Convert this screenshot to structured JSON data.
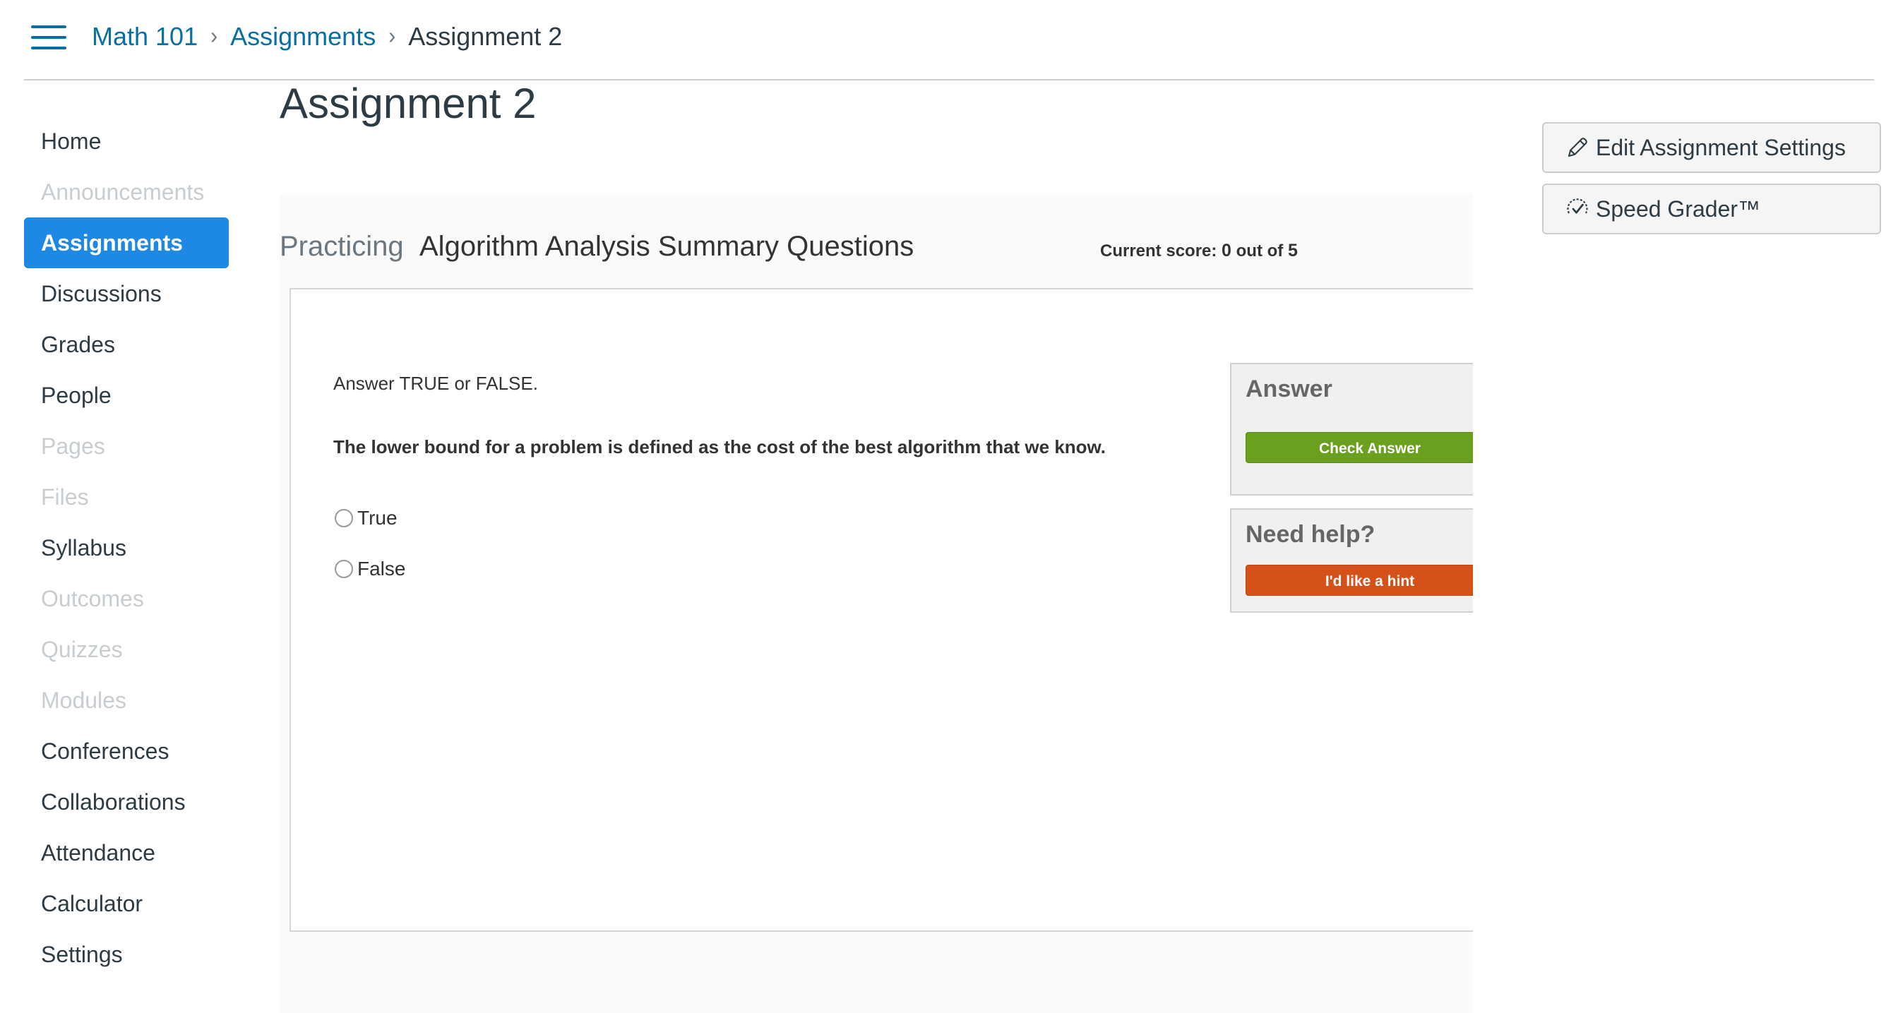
{
  "breadcrumb": {
    "course": "Math 101",
    "section": "Assignments",
    "current": "Assignment 2",
    "separator": "›"
  },
  "page_title": "Assignment 2",
  "nav": {
    "items": [
      {
        "label": "Home",
        "state": "enabled"
      },
      {
        "label": "Announcements",
        "state": "disabled"
      },
      {
        "label": "Assignments",
        "state": "active"
      },
      {
        "label": "Discussions",
        "state": "enabled"
      },
      {
        "label": "Grades",
        "state": "enabled"
      },
      {
        "label": "People",
        "state": "enabled"
      },
      {
        "label": "Pages",
        "state": "disabled"
      },
      {
        "label": "Files",
        "state": "disabled"
      },
      {
        "label": "Syllabus",
        "state": "enabled"
      },
      {
        "label": "Outcomes",
        "state": "disabled"
      },
      {
        "label": "Quizzes",
        "state": "disabled"
      },
      {
        "label": "Modules",
        "state": "disabled"
      },
      {
        "label": "Conferences",
        "state": "enabled"
      },
      {
        "label": "Collaborations",
        "state": "enabled"
      },
      {
        "label": "Attendance",
        "state": "enabled"
      },
      {
        "label": "Calculator",
        "state": "enabled"
      },
      {
        "label": "Settings",
        "state": "enabled"
      }
    ]
  },
  "sidebar_buttons": {
    "edit_label": "Edit Assignment Settings",
    "speed_label": "Speed Grader™"
  },
  "exercise": {
    "mode": "Practicing",
    "title": "Algorithm Analysis Summary Questions",
    "score": {
      "label": "Current score:",
      "current": "0",
      "sep": "out of",
      "total": "5"
    },
    "instruction": "Answer TRUE or FALSE.",
    "question": "The lower bound for a problem is defined as the cost of the best algorithm that we know.",
    "choices": [
      "True",
      "False"
    ],
    "answer_box": {
      "title": "Answer",
      "button": "Check Answer"
    },
    "help_box": {
      "title": "Need help?",
      "button": "I'd like a hint"
    }
  },
  "colors": {
    "link": "#0770a3",
    "active_nav": "#1e88e5",
    "check_button": "#6aa01e",
    "hint_button": "#d6511a"
  }
}
